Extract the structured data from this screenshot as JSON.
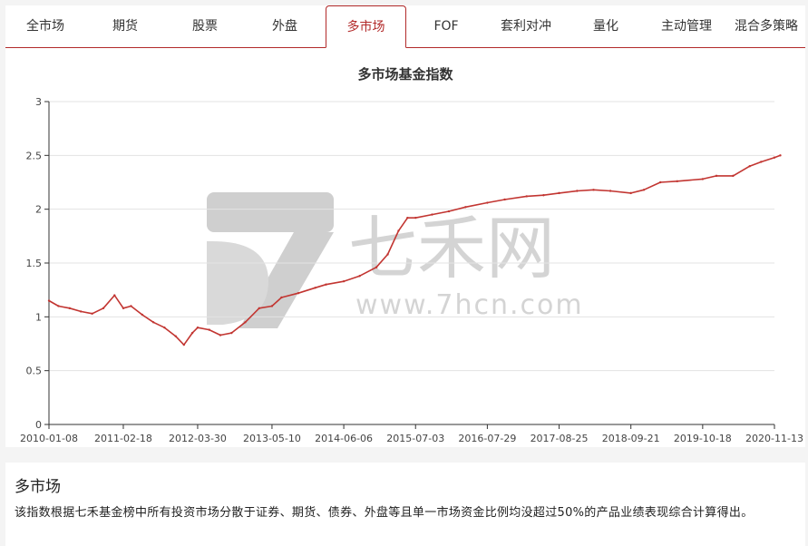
{
  "tabs": [
    "全市场",
    "期货",
    "股票",
    "外盘",
    "多市场",
    "FOF",
    "套利对冲",
    "量化",
    "主动管理",
    "混合多策略"
  ],
  "active_tab": 4,
  "chart_data": {
    "type": "line",
    "title": "多市场基金指数",
    "xlabel": "",
    "ylabel": "",
    "ylim": [
      0,
      3
    ],
    "yticks": [
      "0",
      "0.5",
      "1",
      "1.5",
      "2",
      "2.5",
      "3"
    ],
    "xticks": [
      "2010-01-08",
      "2011-02-18",
      "2012-03-30",
      "2013-05-10",
      "2014-06-06",
      "2015-07-03",
      "2016-07-29",
      "2017-08-25",
      "2018-09-21",
      "2019-10-18",
      "2020-11-13"
    ],
    "grid": true,
    "line_color": "#c23531",
    "series": [
      {
        "name": "",
        "points": [
          [
            "2010-01-08",
            1.15
          ],
          [
            "2010-03-01",
            1.1
          ],
          [
            "2010-05-01",
            1.08
          ],
          [
            "2010-07-01",
            1.05
          ],
          [
            "2010-09-01",
            1.03
          ],
          [
            "2010-11-01",
            1.08
          ],
          [
            "2011-01-01",
            1.2
          ],
          [
            "2011-02-18",
            1.08
          ],
          [
            "2011-04-01",
            1.1
          ],
          [
            "2011-06-01",
            1.02
          ],
          [
            "2011-08-01",
            0.95
          ],
          [
            "2011-10-01",
            0.9
          ],
          [
            "2011-12-01",
            0.82
          ],
          [
            "2012-01-15",
            0.74
          ],
          [
            "2012-03-01",
            0.85
          ],
          [
            "2012-03-30",
            0.9
          ],
          [
            "2012-06-01",
            0.88
          ],
          [
            "2012-08-01",
            0.83
          ],
          [
            "2012-10-01",
            0.85
          ],
          [
            "2012-12-15",
            0.95
          ],
          [
            "2013-03-01",
            1.08
          ],
          [
            "2013-05-10",
            1.1
          ],
          [
            "2013-07-01",
            1.18
          ],
          [
            "2013-10-01",
            1.22
          ],
          [
            "2014-01-01",
            1.27
          ],
          [
            "2014-03-01",
            1.3
          ],
          [
            "2014-06-06",
            1.33
          ],
          [
            "2014-09-01",
            1.38
          ],
          [
            "2014-12-01",
            1.46
          ],
          [
            "2015-02-01",
            1.58
          ],
          [
            "2015-04-01",
            1.8
          ],
          [
            "2015-05-20",
            1.92
          ],
          [
            "2015-07-03",
            1.92
          ],
          [
            "2015-10-01",
            1.95
          ],
          [
            "2016-01-01",
            1.98
          ],
          [
            "2016-04-01",
            2.02
          ],
          [
            "2016-07-29",
            2.06
          ],
          [
            "2016-11-01",
            2.09
          ],
          [
            "2017-03-01",
            2.12
          ],
          [
            "2017-06-01",
            2.13
          ],
          [
            "2017-08-25",
            2.15
          ],
          [
            "2017-12-01",
            2.17
          ],
          [
            "2018-03-01",
            2.18
          ],
          [
            "2018-06-01",
            2.17
          ],
          [
            "2018-09-21",
            2.15
          ],
          [
            "2018-12-01",
            2.18
          ],
          [
            "2019-03-01",
            2.25
          ],
          [
            "2019-06-01",
            2.26
          ],
          [
            "2019-10-18",
            2.28
          ],
          [
            "2020-01-01",
            2.31
          ],
          [
            "2020-04-01",
            2.31
          ],
          [
            "2020-07-01",
            2.4
          ],
          [
            "2020-09-01",
            2.44
          ],
          [
            "2020-11-13",
            2.48
          ],
          [
            "2020-12-15",
            2.5
          ]
        ]
      }
    ]
  },
  "watermark": {
    "brand": "七禾网",
    "url": "www.7hcn.com"
  },
  "description": {
    "title": "多市场",
    "text": "该指数根据七禾基金榜中所有投资市场分散于证券、期货、债券、外盘等且单一市场资金比例均没超过50%的产品业绩表现综合计算得出。"
  }
}
